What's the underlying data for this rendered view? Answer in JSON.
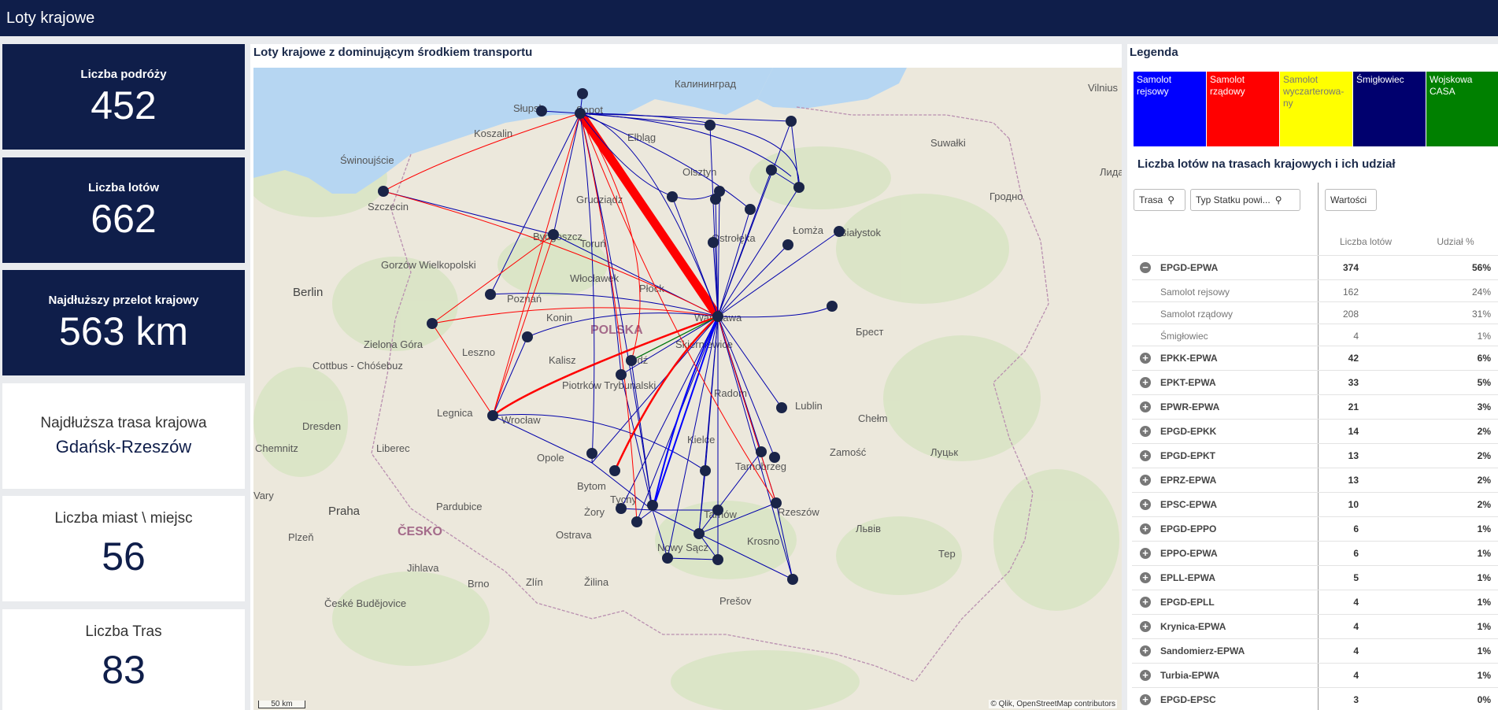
{
  "app": {
    "title": "Loty krajowe"
  },
  "kpis": [
    {
      "label": "Liczba podróży",
      "value": "452"
    },
    {
      "label": "Liczba lotów",
      "value": "662"
    },
    {
      "label": "Najdłuższy przelot krajowy",
      "value": "563 km"
    },
    {
      "label": "Najdłuższa trasa krajowa",
      "value": "Gdańsk-Rzeszów"
    },
    {
      "label": "Liczba miast \\ miejsc",
      "value": "56"
    },
    {
      "label": "Liczba Tras",
      "value": "83"
    }
  ],
  "map": {
    "title": "Loty krajowe z dominującym środkiem transportu",
    "attribution": "© Qlik, OpenStreetMap contributors",
    "scale_label": "50 km",
    "labels": {
      "kaliningrad": "Калининград",
      "vilnius": "Vilnius",
      "slupsk": "Słupsk",
      "sopot": "Sopot",
      "koszalin": "Koszalin",
      "elblag": "Elbląg",
      "suwalki": "Suwałki",
      "swinoujscie": "Świnoujście",
      "olsztyn": "Olsztyn",
      "lida": "Лида",
      "grodno": "Гродно",
      "szczecin": "Szczecin",
      "grudziadz": "Grudziądz",
      "bydgoszcz": "Bydgoszcz",
      "torun": "Toruń",
      "ostroleka": "Ostrołęka",
      "lomza": "Łomża",
      "bialystok": "Białystok",
      "gorzow": "Gorzów Wielkopolski",
      "berlin": "Berlin",
      "wloclawek": "Włocławek",
      "plock": "Płock",
      "poznan": "Poznań",
      "konin": "Konin",
      "warszawa": "Warszawa",
      "polska": "POLSKA",
      "brest": "Брест",
      "zielona_gora": "Zielona Góra",
      "leszno": "Leszno",
      "skierniewice": "Skierniewice",
      "cottbus": "Cottbus - Chóśebuz",
      "kalisz": "Kalisz",
      "lodz": "Łódź",
      "piotrkow": "Piotrków Trybunalski",
      "radom": "Radom",
      "lublin": "Lublin",
      "legnica": "Legnica",
      "wroclaw": "Wrocław",
      "dresden": "Dresden",
      "chelm": "Chełm",
      "chemnitz": "Chemnitz",
      "liberec": "Liberec",
      "opole": "Opole",
      "kielce": "Kielce",
      "tarnobrzeg": "Tarnobrzeg",
      "zamosc": "Zamość",
      "lutsk": "Луцьк",
      "vary": "Vary",
      "pardubice": "Pardubice",
      "bytom": "Bytom",
      "tychy": "Tychy",
      "praha": "Praha",
      "rzeszow": "Rzeszów",
      "tarnow": "Tarnów",
      "zory": "Żory",
      "plzen": "Plzeň",
      "cesko": "ČESKO",
      "ostrava": "Ostrava",
      "lviv": "Львів",
      "nowy_sacz": "Nowy Sącz",
      "krosno": "Krosno",
      "jihlava": "Jihlava",
      "brno": "Brno",
      "zlin": "Zlín",
      "zilina": "Žilina",
      "ceske_budejovice": "České Budějovice",
      "presov": "Prešov",
      "ter": "Тер"
    }
  },
  "legend": {
    "title": "Legenda",
    "items": [
      {
        "label": "Samolot rejsowy",
        "color": "#0000ff",
        "text_color": "#ffffff"
      },
      {
        "label": "Samolot rządowy",
        "color": "#ff0000",
        "text_color": "#ffffff"
      },
      {
        "label": "Samolot wyczarterowa-ny",
        "color": "#ffff00",
        "text_color": "#777777"
      },
      {
        "label": "Śmigłowiec",
        "color": "#00006e",
        "text_color": "#ffffff"
      },
      {
        "label": "Wojskowa CASA",
        "color": "#008000",
        "text_color": "#ffffff"
      }
    ]
  },
  "table": {
    "title": "Liczba lotów na trasach krajowych i ich udział",
    "filters": {
      "trasa": "Trasa",
      "typ": "Typ Statku powi...",
      "wartosci": "Wartości"
    },
    "columns": {
      "count": "Liczba lotów",
      "share": "Udział %"
    },
    "rows": [
      {
        "route": "EPGD-EPWA",
        "count": "374",
        "share": "56%",
        "kind": "main",
        "expanded": true
      },
      {
        "route": "Samolot rejsowy",
        "count": "162",
        "share": "24%",
        "kind": "sub"
      },
      {
        "route": "Samolot rządowy",
        "count": "208",
        "share": "31%",
        "kind": "sub"
      },
      {
        "route": "Śmigłowiec",
        "count": "4",
        "share": "1%",
        "kind": "sub"
      },
      {
        "route": "EPKK-EPWA",
        "count": "42",
        "share": "6%",
        "kind": "main"
      },
      {
        "route": "EPKT-EPWA",
        "count": "33",
        "share": "5%",
        "kind": "main"
      },
      {
        "route": "EPWR-EPWA",
        "count": "21",
        "share": "3%",
        "kind": "main"
      },
      {
        "route": "EPGD-EPKK",
        "count": "14",
        "share": "2%",
        "kind": "main"
      },
      {
        "route": "EPGD-EPKT",
        "count": "13",
        "share": "2%",
        "kind": "main"
      },
      {
        "route": "EPRZ-EPWA",
        "count": "13",
        "share": "2%",
        "kind": "main"
      },
      {
        "route": "EPSC-EPWA",
        "count": "10",
        "share": "2%",
        "kind": "main"
      },
      {
        "route": "EPGD-EPPO",
        "count": "6",
        "share": "1%",
        "kind": "main"
      },
      {
        "route": "EPPO-EPWA",
        "count": "6",
        "share": "1%",
        "kind": "main"
      },
      {
        "route": "EPLL-EPWA",
        "count": "5",
        "share": "1%",
        "kind": "main"
      },
      {
        "route": "EPGD-EPLL",
        "count": "4",
        "share": "1%",
        "kind": "main"
      },
      {
        "route": "Krynica-EPWA",
        "count": "4",
        "share": "1%",
        "kind": "main"
      },
      {
        "route": "Sandomierz-EPWA",
        "count": "4",
        "share": "1%",
        "kind": "main"
      },
      {
        "route": "Turbia-EPWA",
        "count": "4",
        "share": "1%",
        "kind": "main"
      },
      {
        "route": "EPGD-EPSC",
        "count": "3",
        "share": "0%",
        "kind": "main"
      }
    ]
  }
}
